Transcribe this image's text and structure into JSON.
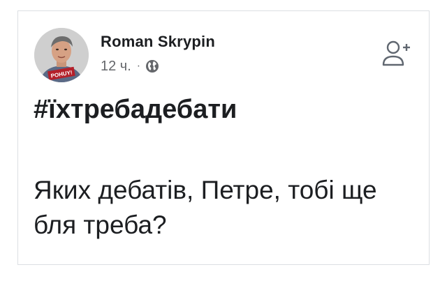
{
  "post": {
    "author_name": "Roman Skrypin",
    "timestamp": "12 ч.",
    "separator": "·",
    "audience_icon": "globe-icon",
    "avatar_badge": "POHUY!",
    "action_icon": "add-friend-icon",
    "hashtag": "#їхтребадебати",
    "text": "Яких дебатів, Петре, тобі ще бля треба?"
  },
  "colors": {
    "text_primary": "#1c1e21",
    "text_secondary": "#65676b",
    "border": "#dcdfe3",
    "badge": "#b4202a"
  }
}
